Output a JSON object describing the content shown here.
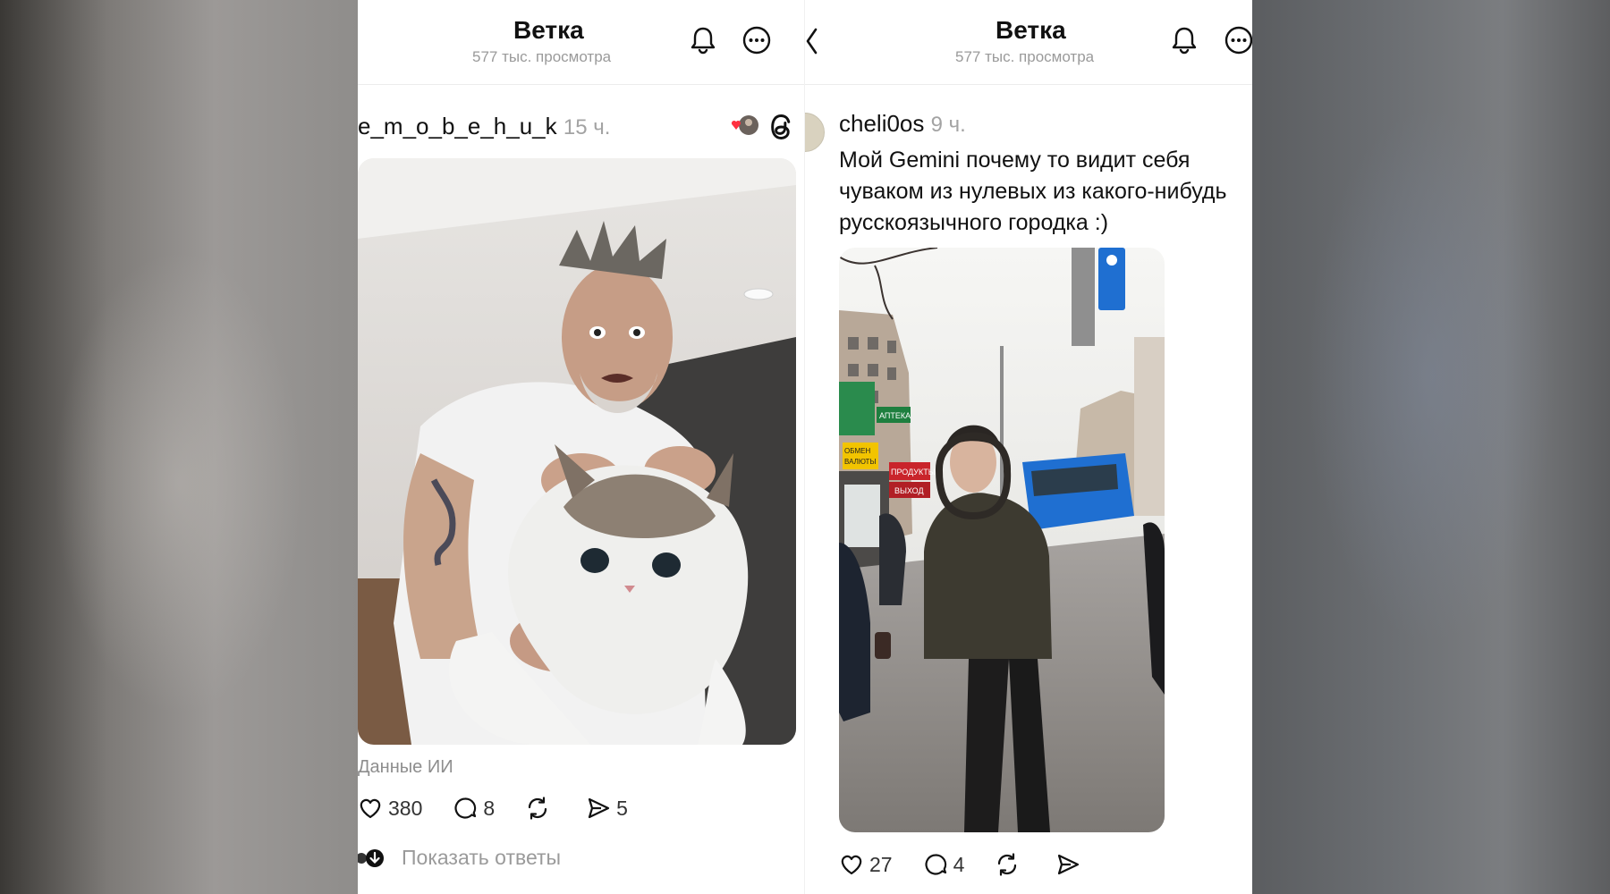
{
  "left": {
    "header": {
      "title": "Ветка",
      "views": "577 тыс. просмотра"
    },
    "post": {
      "username": "e_m_o_b_e_h_u_k",
      "time": "15 ч.",
      "ai_label": "Данные ИИ",
      "likes": "380",
      "comments": "8",
      "shares": "5",
      "show_replies": "Показать ответы"
    }
  },
  "right": {
    "header": {
      "title": "Ветка",
      "views": "577 тыс. просмотра"
    },
    "post": {
      "username": "cheli0os",
      "time": "9 ч.",
      "text_lines": [
        "Мой Gemini почему то видит себя",
        "чуваком из нулевых из какого-нибудь",
        "русскоязычного городка :)"
      ],
      "likes": "27",
      "comments": "4"
    },
    "signs": {
      "pharmacy": "АПТЕКА",
      "exchange_1": "ОБМЕН",
      "exchange_2": "ВАЛЮТЫ",
      "products": "ПРОДУКТЫ",
      "exit": "ВЫХОД"
    }
  },
  "colors": {
    "accent_red": "#ff3040",
    "bus_blue": "#1f6fd1",
    "text": "#111111",
    "muted": "#9a9a9a"
  },
  "icons": [
    "bell-icon",
    "more-icon",
    "back-chevron-icon",
    "threads-icon",
    "heart-icon",
    "comment-icon",
    "repost-icon",
    "share-icon"
  ]
}
